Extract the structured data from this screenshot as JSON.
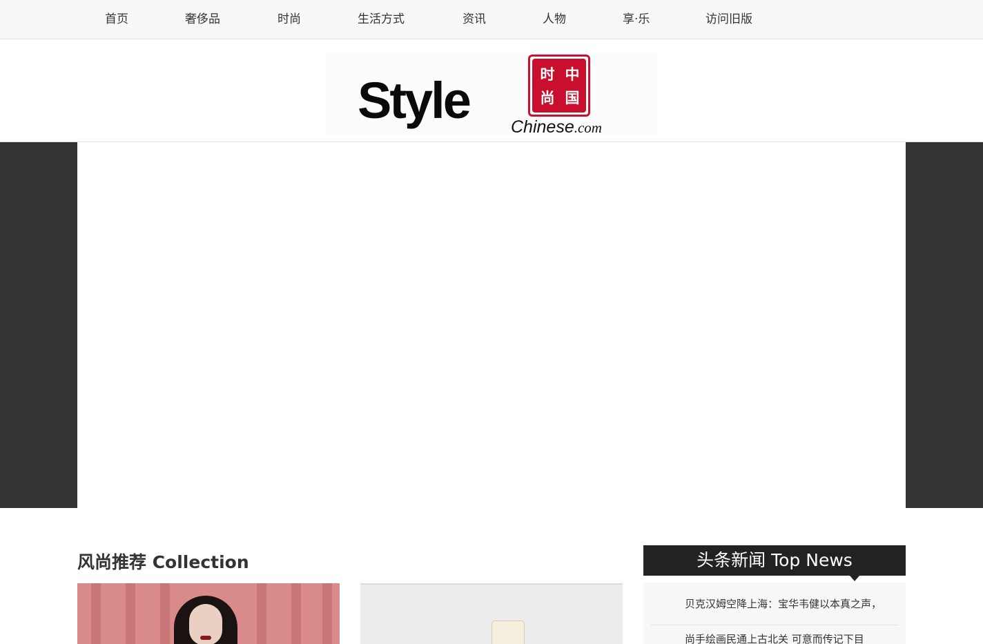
{
  "nav": {
    "items": [
      {
        "label": "首页"
      },
      {
        "label": "奢侈品"
      },
      {
        "label": "时尚"
      },
      {
        "label": "生活方式"
      },
      {
        "label": "资讯"
      },
      {
        "label": "人物"
      },
      {
        "label": "享·乐"
      },
      {
        "label": "访问旧版"
      }
    ]
  },
  "logo": {
    "wordmark": "Style",
    "suffix": "Chinese",
    "domain": ".com",
    "seal": [
      "时",
      "中",
      "尚",
      "国"
    ],
    "seal_color": "#c8102e"
  },
  "collection": {
    "title": "风尚推荐 Collection"
  },
  "top_news": {
    "title": "头条新闻 Top News",
    "items": [
      {
        "title": "贝克汉姆空降上海：宝华韦健以本真之声，"
      },
      {
        "title": "尚手绘画民通上古北关 可意而传记下目"
      }
    ]
  },
  "colors": {
    "hero_background": "#333333",
    "news_header": "#222222",
    "nav_background": "#f8f8f8"
  }
}
